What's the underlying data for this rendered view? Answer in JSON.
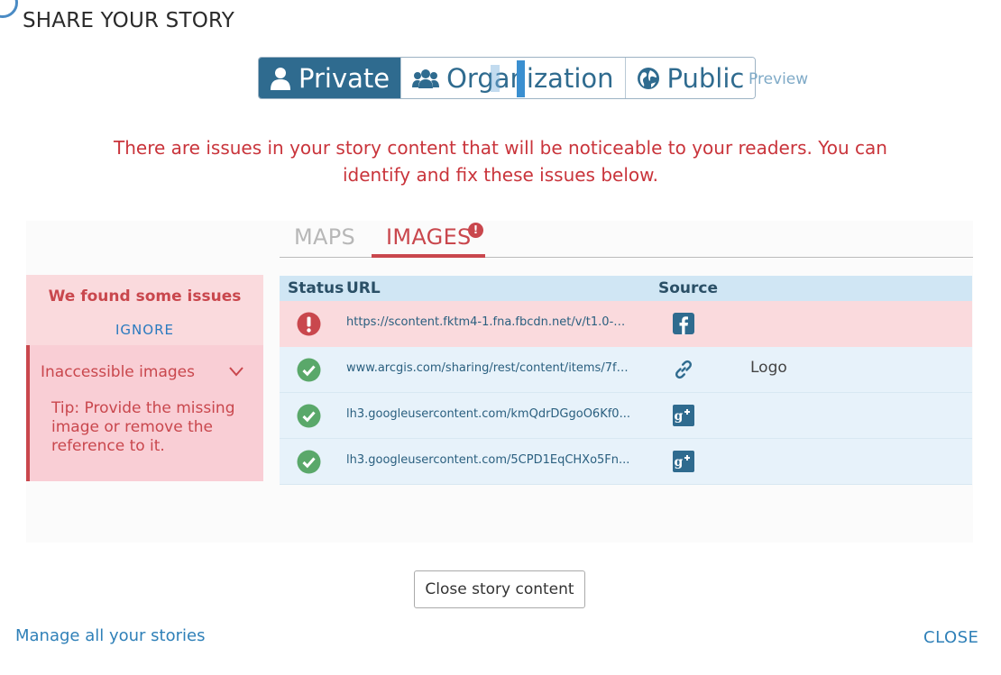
{
  "dialog": {
    "title": "SHARE YOUR STORY"
  },
  "share": {
    "options": [
      {
        "label": "Private",
        "icon": "user-icon"
      },
      {
        "label": "Organization",
        "icon": "group-icon"
      },
      {
        "label": "Public",
        "icon": "globe-icon"
      }
    ],
    "selected": "Private",
    "preview_label": "Preview"
  },
  "warning": "There are issues in your story content that will be noticeable to your readers. You can identify and fix these issues below.",
  "tabs": {
    "maps": "MAPS",
    "images": "IMAGES",
    "images_badge": "!"
  },
  "issues": {
    "title": "We found some issues",
    "ignore": "IGNORE",
    "item_label": "Inaccessible images",
    "tip": "Tip: Provide the missing image or remove the reference to it."
  },
  "table": {
    "headers": {
      "status": "Status",
      "url": "URL",
      "source": "Source"
    },
    "rows": [
      {
        "status": "error",
        "url": "https://scontent.fktm4-1.fna.fbcdn.net/v/t1.0-9/...",
        "source": "facebook-icon",
        "caption": ""
      },
      {
        "status": "ok",
        "url": "www.arcgis.com/sharing/rest/content/items/7f8...",
        "source": "link-icon",
        "caption": "Logo"
      },
      {
        "status": "ok",
        "url": "lh3.googleusercontent.com/kmQdrDGgoO6Kf0...",
        "source": "google-plus-icon",
        "caption": ""
      },
      {
        "status": "ok",
        "url": "lh3.googleusercontent.com/5CPD1EqCHXo5Fn...",
        "source": "google-plus-icon",
        "caption": ""
      }
    ]
  },
  "footer": {
    "close_content": "Close story content",
    "manage": "Manage all your stories",
    "close": "CLOSE"
  },
  "colors": {
    "accent": "#2f6b8f",
    "error": "#c9474d",
    "ok": "#5aa86a",
    "link": "#2f80b8"
  }
}
